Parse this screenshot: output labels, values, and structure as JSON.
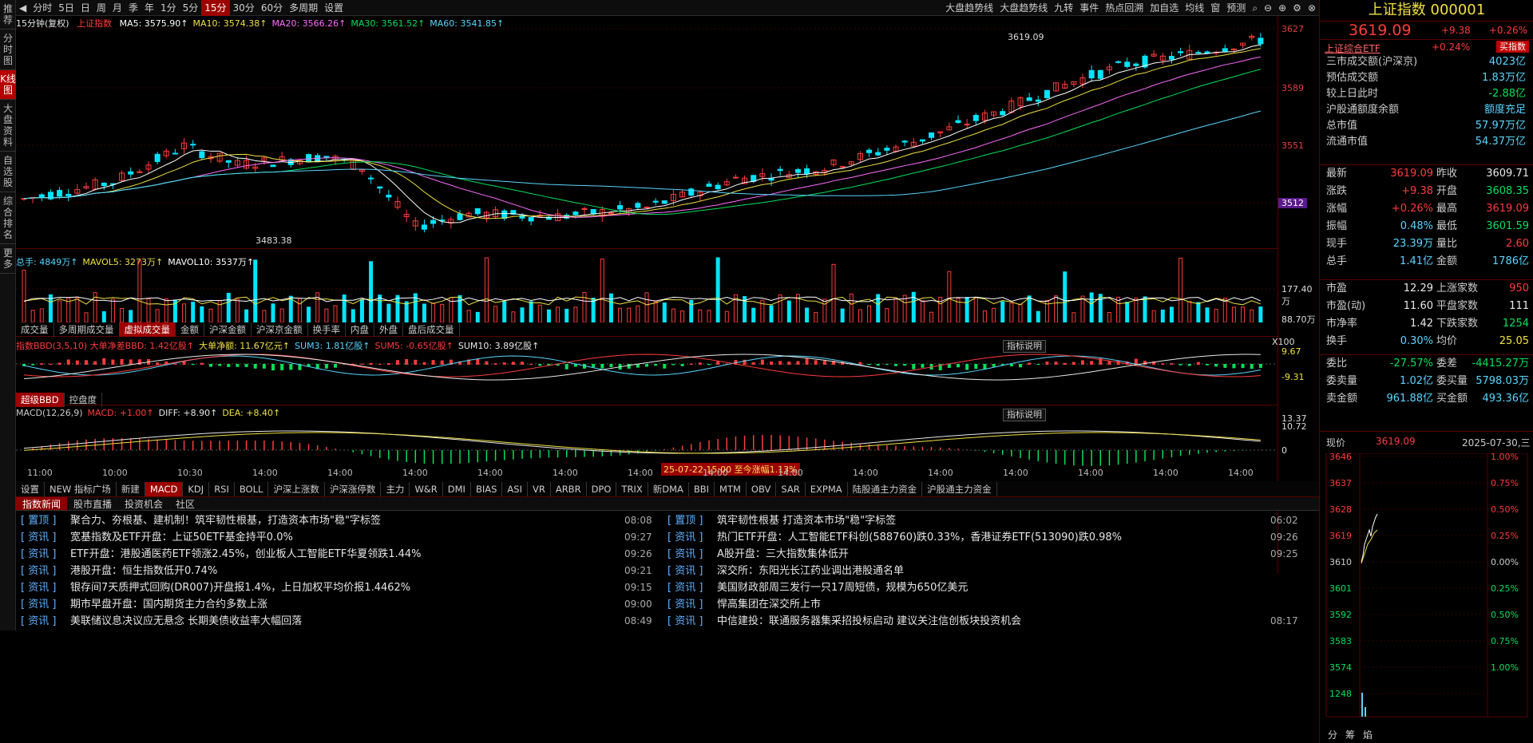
{
  "leftnav": [
    "推荐",
    "分时图",
    "K线图",
    "大盘资料",
    "自选股",
    "综合排名",
    "更多"
  ],
  "toolbar": {
    "periods": [
      "分时",
      "5日",
      "日",
      "周",
      "月",
      "季",
      "年",
      "1分",
      "5分",
      "15分",
      "30分",
      "60分",
      "多周期",
      "设置"
    ],
    "active": "15分",
    "right": [
      "大盘趋势线",
      "大盘趋势线",
      "九转",
      "事件",
      "热点回溯",
      "加自选",
      "均线",
      "窗",
      "预测"
    ]
  },
  "kline": {
    "period_label": "15分钟(复权)",
    "index_name": "上证指数",
    "ma": [
      {
        "label": "MA5: 3575.90↑",
        "color": "#ffffff"
      },
      {
        "label": "MA10: 3574.38↑",
        "color": "#f0e040"
      },
      {
        "label": "MA20: 3566.26↑",
        "color": "#ff6cff"
      },
      {
        "label": "MA30: 3561.52↑",
        "color": "#00e05a"
      },
      {
        "label": "MA60: 3541.85↑",
        "color": "#58d6ff"
      }
    ],
    "price_ticks": [
      "3627",
      "3589",
      "3551",
      "3512"
    ],
    "highlight_tick": "3512",
    "high_label": "3619.09",
    "low_label": "3483.38"
  },
  "volume": {
    "legend": [
      {
        "label": "总手: 4849万↑",
        "color": "#58d6ff"
      },
      {
        "label": "MAVOL5: 3273万↑",
        "color": "#f0e040"
      },
      {
        "label": "MAVOL10: 3537万↑",
        "color": "#ffffff"
      }
    ],
    "ticks": [
      "177.40万",
      "88.70万",
      "X100"
    ],
    "tabs": [
      "成交量",
      "多周期成交量",
      "虚拟成交量",
      "金额",
      "沪深金额",
      "沪深京金额",
      "换手率",
      "内盘",
      "外盘",
      "盘后成交量"
    ],
    "active_tab": "虚拟成交量"
  },
  "bbd": {
    "legend": [
      {
        "label": "指数BBD(3,5,10) 大单净差BBD: 1.42亿股↑",
        "color": "#ff3b3b"
      },
      {
        "label": "大单净额: 11.67亿元↑",
        "color": "#f0e040"
      },
      {
        "label": "SUM3: 1.81亿股↑",
        "color": "#58d6ff"
      },
      {
        "label": "SUM5: -0.65亿股↑",
        "color": "#ff3b3b"
      },
      {
        "label": "SUM10: 3.89亿股↑",
        "color": "#e8e8e8"
      }
    ],
    "ticks": [
      "9.67",
      "-9.31"
    ],
    "explain": "指标说明",
    "tabs": [
      "超级BBD",
      "控盘度"
    ],
    "active_tab": "超级BBD"
  },
  "macd": {
    "legend": [
      {
        "label": "MACD(12,26,9)",
        "color": "#cccccc"
      },
      {
        "label": "MACD: +1.00↑",
        "color": "#ff3b3b"
      },
      {
        "label": "DIFF: +8.90↑",
        "color": "#e8e8e8"
      },
      {
        "label": "DEA: +8.40↑",
        "color": "#f0e040"
      }
    ],
    "ticks": [
      "13.37",
      "10.72",
      "0"
    ],
    "explain": "指标说明",
    "tooltip": "25-07-22 15:00 至今涨幅1.13%"
  },
  "xaxis": [
    "11:00",
    "10:00",
    "10:30",
    "14:00",
    "14:00",
    "14:00",
    "14:00",
    "14:00",
    "14:00",
    "14:00",
    "14:00",
    "14:00",
    "14:00",
    "14:00",
    "14:00",
    "14:00",
    "14:00"
  ],
  "indicator_tabs": [
    "设置",
    "NEW 指标广场",
    "新建",
    "MACD",
    "KDJ",
    "RSI",
    "BOLL",
    "沪深上涨数",
    "沪深涨停数",
    "主力",
    "W&R",
    "DMI",
    "BIAS",
    "ASI",
    "VR",
    "ARBR",
    "DPO",
    "TRIX",
    "新DMA",
    "BBI",
    "MTM",
    "OBV",
    "SAR",
    "EXPMA",
    "陆股通主力资金",
    "沪股通主力资金"
  ],
  "active_indicator": "MACD",
  "news": {
    "tabs": [
      "指数新闻",
      "股市直播",
      "投资机会",
      "社区"
    ],
    "active": "指数新闻",
    "left": [
      {
        "tag": "[ 置顶 ]",
        "title": "聚合力、夯根基、建机制！筑牢韧性根基，打造资本市场\"稳\"字标签",
        "time": "08:08"
      },
      {
        "tag": "[ 资讯 ]",
        "title": "宽基指数及ETF开盘：上证50ETF基金持平0.0%",
        "time": "09:27"
      },
      {
        "tag": "[ 资讯 ]",
        "title": "ETF开盘：港股通医药ETF领涨2.45%，创业板人工智能ETF华夏领跌1.44%",
        "time": "09:26"
      },
      {
        "tag": "[ 资讯 ]",
        "title": "港股开盘：恒生指数低开0.74%",
        "time": "09:21"
      },
      {
        "tag": "[ 资讯 ]",
        "title": "银存间7天质押式回购(DR007)开盘报1.4%，上日加权平均价报1.4462%",
        "time": "09:15"
      },
      {
        "tag": "[ 资讯 ]",
        "title": "期市早盘开盘：国内期货主力合约多数上涨",
        "time": "09:00"
      },
      {
        "tag": "[ 资讯 ]",
        "title": "美联储议息决议应无悬念 长期美债收益率大幅回落",
        "time": "08:49"
      }
    ],
    "right": [
      {
        "tag": "[ 置顶 ]",
        "title": "筑牢韧性根基 打造资本市场\"稳\"字标签",
        "time": "06:02"
      },
      {
        "tag": "[ 资讯 ]",
        "title": "热门ETF开盘：人工智能ETF科创(588760)跌0.33%，香港证券ETF(513090)跌0.98%",
        "time": "09:26"
      },
      {
        "tag": "[ 资讯 ]",
        "title": "A股开盘：三大指数集体低开",
        "time": "09:25"
      },
      {
        "tag": "[ 资讯 ]",
        "title": "深交所：东阳光长江药业调出港股通名单",
        "time": ""
      },
      {
        "tag": "[ 资讯 ]",
        "title": "美国财政部周三发行一只17周短债，规模为650亿美元",
        "time": ""
      },
      {
        "tag": "[ 资讯 ]",
        "title": "悍高集团在深交所上市",
        "time": ""
      },
      {
        "tag": "[ 资讯 ]",
        "title": "中信建投：联通服务器集采招投标启动 建议关注信创板块投资机会",
        "time": "08:17"
      }
    ]
  },
  "right_panel": {
    "title": "上证指数 000001",
    "price": "3619.09",
    "change": "+9.38",
    "pct": "+0.26%",
    "etf_name": "上证综合ETF",
    "etf_pct": "+0.24%",
    "buy_label": "买指数",
    "stats": [
      {
        "label": "三市成交额(沪深京)",
        "value": "4023亿",
        "color": "#58d6ff"
      },
      {
        "label": "预估成交额",
        "value": "1.83万亿",
        "color": "#58d6ff"
      },
      {
        "label": "较上日此时",
        "value": "-2.88亿",
        "color": "#00e05a"
      },
      {
        "label": "沪股通额度余额",
        "value": "额度充足",
        "color": "#58d6ff"
      },
      {
        "label": "总市值",
        "value": "57.97万亿",
        "color": "#58d6ff"
      },
      {
        "label": "流通市值",
        "value": "54.37万亿",
        "color": "#58d6ff"
      }
    ],
    "quote": [
      {
        "l1": "最新",
        "v1": "3619.09",
        "c1": "#ff3b3b",
        "l2": "昨收",
        "v2": "3609.71",
        "c2": "#e8e8e8"
      },
      {
        "l1": "涨跌",
        "v1": "+9.38",
        "c1": "#ff3b3b",
        "l2": "开盘",
        "v2": "3608.35",
        "c2": "#00e05a"
      },
      {
        "l1": "涨幅",
        "v1": "+0.26%",
        "c1": "#ff3b3b",
        "l2": "最高",
        "v2": "3619.09",
        "c2": "#ff3b3b"
      },
      {
        "l1": "振幅",
        "v1": "0.48%",
        "c1": "#58d6ff",
        "l2": "最低",
        "v2": "3601.59",
        "c2": "#00e05a"
      },
      {
        "l1": "现手",
        "v1": "23.39万",
        "c1": "#58d6ff",
        "l2": "量比",
        "v2": "2.60",
        "c2": "#ff3b3b"
      },
      {
        "l1": "总手",
        "v1": "1.41亿",
        "c1": "#58d6ff",
        "l2": "金额",
        "v2": "1786亿",
        "c2": "#58d6ff"
      }
    ],
    "market": [
      {
        "l1": "市盈",
        "v1": "12.29",
        "c1": "#e8e8e8",
        "l2": "上涨家数",
        "v2": "950",
        "c2": "#ff3b3b"
      },
      {
        "l1": "市盈(动)",
        "v1": "11.60",
        "c1": "#e8e8e8",
        "l2": "平盘家数",
        "v2": "111",
        "c2": "#e8e8e8"
      },
      {
        "l1": "市净率",
        "v1": "1.42",
        "c1": "#e8e8e8",
        "l2": "下跌家数",
        "v2": "1254",
        "c2": "#00e05a"
      },
      {
        "l1": "换手",
        "v1": "0.30%",
        "c1": "#58d6ff",
        "l2": "均价",
        "v2": "25.05",
        "c2": "#f0e040"
      }
    ],
    "order": [
      {
        "l1": "委比",
        "v1": "-27.57%",
        "c1": "#00e05a",
        "l2": "委差",
        "v2": "-4415.27万",
        "c2": "#00e05a"
      },
      {
        "l1": "委卖量",
        "v1": "1.02亿",
        "c1": "#58d6ff",
        "l2": "委买量",
        "v2": "5798.03万",
        "c2": "#58d6ff"
      },
      {
        "l1": "卖金额",
        "v1": "961.88亿",
        "c1": "#58d6ff",
        "l2": "买金额",
        "v2": "493.36亿",
        "c2": "#58d6ff"
      }
    ],
    "mini": {
      "label": "现价",
      "price": "3619.09",
      "date": "2025-07-30,三",
      "ticks_l": [
        "3646",
        "3637",
        "3628",
        "3619",
        "3610",
        "3601",
        "3592",
        "3583",
        "3574",
        "1248"
      ],
      "ticks_r": [
        "1.00%",
        "0.75%",
        "0.50%",
        "0.25%",
        "0.00%",
        "0.25%",
        "0.50%",
        "0.75%",
        "1.00%"
      ]
    },
    "bottom": [
      "分",
      "筹",
      "焰"
    ]
  },
  "colors": {
    "up": "#ff3b3b",
    "down": "#00e5ff",
    "ma5": "#ffffff",
    "ma10": "#f0e040",
    "ma20": "#ff6cff",
    "ma30": "#00e05a",
    "ma60": "#58d6ff"
  }
}
